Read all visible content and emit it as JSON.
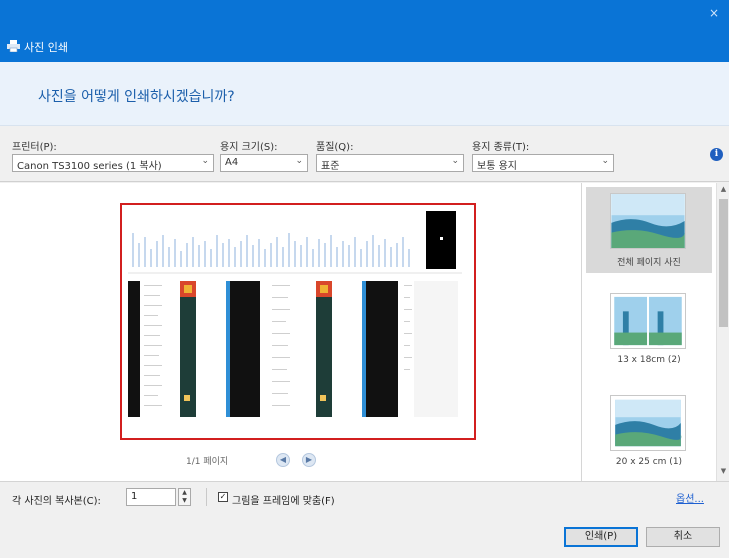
{
  "window": {
    "title": "사진 인쇄",
    "close_glyph": "×"
  },
  "header": {
    "question": "사진을 어떻게 인쇄하시겠습니까?"
  },
  "controls": {
    "printer_label": "프린터(P):",
    "printer_value": "Canon TS3100 series (1 복사)",
    "paper_size_label": "용지 크기(S):",
    "paper_size_value": "A4",
    "quality_label": "품질(Q):",
    "quality_value": "표준",
    "paper_type_label": "용지 종류(T):",
    "paper_type_value": "보통 용지",
    "info_glyph": "i"
  },
  "preview": {
    "page_indicator": "1/1 페이지",
    "prev_glyph": "◀",
    "next_glyph": "▶"
  },
  "layouts": {
    "items": [
      {
        "caption": "전체 페이지 사진"
      },
      {
        "caption": "13 x 18cm (2)"
      },
      {
        "caption": "20 x 25 cm (1)"
      }
    ],
    "scroll_up": "▲",
    "scroll_down": "▼"
  },
  "footer": {
    "copies_label": "각 사진의 복사본(C):",
    "copies_value": "1",
    "fit_frame_label": "그림을 프레임에 맞춤(F)",
    "fit_frame_checked": true,
    "check_glyph": "✓",
    "options_link": "옵션...",
    "print_button": "인쇄(P)",
    "cancel_button": "취소"
  },
  "colors": {
    "titlebar": "#0a74d6",
    "selection_border": "#d21f1f",
    "link": "#1d5fd1"
  }
}
